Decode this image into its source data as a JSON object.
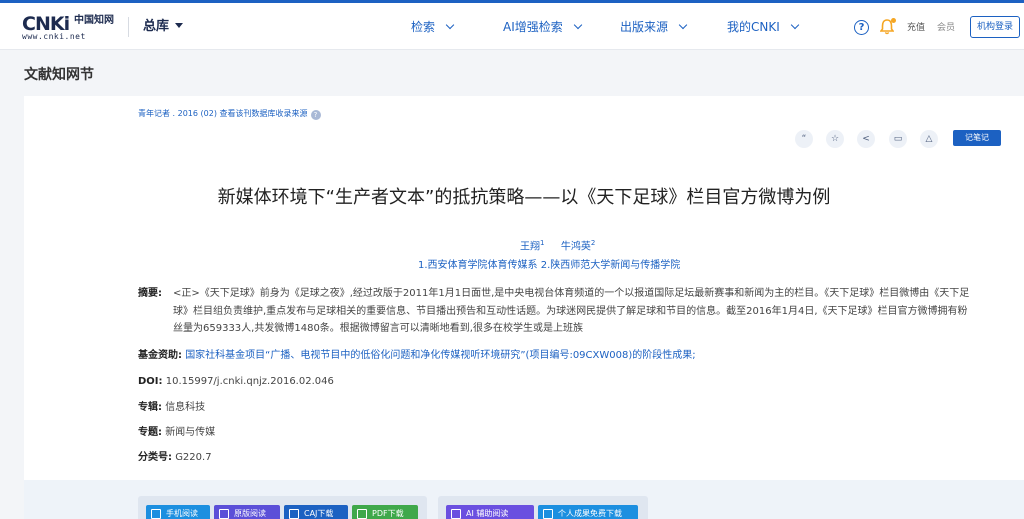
{
  "header": {
    "logo_mark": "CNKi",
    "logo_zh": "中国知网",
    "logo_url": "www.cnki.net",
    "library": "总库",
    "nav": [
      {
        "label": "检索"
      },
      {
        "label": "AI增强检索"
      },
      {
        "label": "出版来源"
      },
      {
        "label": "我的CNKI"
      }
    ],
    "help_glyph": "?",
    "recharge": "充值",
    "member": "会员",
    "inst_login": "机构登录"
  },
  "page_title": "文献知网节",
  "article": {
    "source_line": "青年记者 . 2016 (02)  查看该刊数据库收录来源",
    "help_glyph": "?",
    "toolbar": {
      "quote_glyph": "“",
      "star_glyph": "☆",
      "share_glyph": "<",
      "print_glyph": "▭",
      "bell_glyph": "△",
      "note_label": "记笔记"
    },
    "title": "新媒体环境下“生产者文本”的抵抗策略——以《天下足球》栏目官方微博为例",
    "authors": [
      {
        "name": "王翔",
        "sup": "1"
      },
      {
        "name": "牛鸿英",
        "sup": "2"
      }
    ],
    "affiliations": "1.西安体育学院体育传媒系    2.陕西师范大学新闻与传播学院",
    "abstract_label": "摘要:",
    "abstract_lines": [
      "<正>《天下足球》前身为《足球之夜》,经过改版于2011年1月1日面世,是中央电视台体育频道的一个以报道国际足坛最新赛事和新闻为主的栏目。《天下足球》栏目微博由《天下足",
      "球》栏目组负责维护,重点发布与足球相关的重要信息、节目播出预告和互动性话题。为球迷网民提供了解足球和节目的信息。截至2016年1月4日,《天下足球》栏目官方微博拥有粉",
      "丝量为659333人,共发微博1480条。根据微博留言可以清晰地看到,很多在校学生或是上班族"
    ],
    "fund_label": "基金资助:",
    "fund_value": "国家社科基金项目“广播、电视节目中的低俗化问题和净化传媒视听环境研究”(项目编号:09CXW008)的阶段性成果;",
    "doi_label": "DOI:",
    "doi_value": "10.15997/j.cnki.qnjz.2016.02.046",
    "series_label": "专辑:",
    "series_value": "信息科技",
    "topic_label": "专题:",
    "topic_value": "新闻与传媒",
    "class_label": "分类号:",
    "class_value": "G220.7"
  },
  "downloads": {
    "buttons": [
      {
        "label": "手机阅读",
        "color": "#1c8fe0"
      },
      {
        "label": "原版阅读",
        "color": "#5b4fd8"
      },
      {
        "label": "CAJ下载",
        "color": "#1c61c2"
      },
      {
        "label": "PDF下载",
        "color": "#3fa84a"
      }
    ],
    "ai_buttons": [
      {
        "label": "AI 辅助阅读",
        "color": "#6a4fe0"
      },
      {
        "label": "个人成果免费下载",
        "color": "#1c8fe0"
      }
    ]
  },
  "colors": {
    "brand": "#1c61c2",
    "link": "#1c61c2",
    "background": "#f3f5f8"
  }
}
